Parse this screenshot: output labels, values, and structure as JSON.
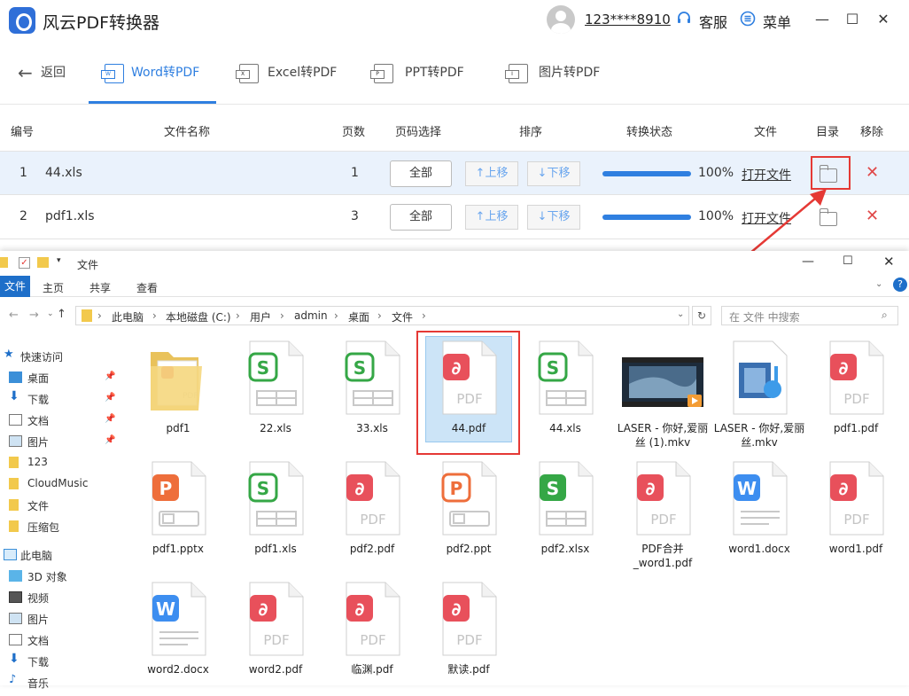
{
  "app": {
    "title": "风云PDF转换器",
    "username": "123****8910",
    "service": "客服",
    "menu": "菜单"
  },
  "nav": {
    "back": "返回",
    "tabs": [
      "Word转PDF",
      "Excel转PDF",
      "PPT转PDF",
      "图片转PDF"
    ]
  },
  "table": {
    "headers": [
      "编号",
      "文件名称",
      "页数",
      "页码选择",
      "排序",
      "转换状态",
      "文件",
      "目录",
      "移除"
    ],
    "rows": [
      {
        "num": "1",
        "name": "44.xls",
        "pages": "1",
        "range": "全部",
        "up": "↑上移",
        "down": "↓下移",
        "progress": 100,
        "status": "100%",
        "open": "打开文件"
      },
      {
        "num": "2",
        "name": "pdf1.xls",
        "pages": "3",
        "range": "全部",
        "up": "↑上移",
        "down": "↓下移",
        "progress": 100,
        "status": "100%",
        "open": "打开文件"
      }
    ]
  },
  "explorer": {
    "title": "文件",
    "ribbon": [
      "文件",
      "主页",
      "共享",
      "查看"
    ],
    "path": [
      "此电脑",
      "本地磁盘 (C:)",
      "用户",
      "admin",
      "桌面",
      "文件"
    ],
    "search_placeholder": "在 文件 中搜索",
    "sidebar": {
      "quick": "快速访问",
      "items": [
        "桌面",
        "下载",
        "文档",
        "图片",
        "123",
        "CloudMusic",
        "文件",
        "压缩包"
      ],
      "pc": "此电脑",
      "pc_items": [
        "3D 对象",
        "视频",
        "图片",
        "文档",
        "下载",
        "音乐"
      ]
    },
    "files": [
      {
        "name": "pdf1",
        "type": "folder"
      },
      {
        "name": "22.xls",
        "type": "xls"
      },
      {
        "name": "33.xls",
        "type": "xls"
      },
      {
        "name": "44.pdf",
        "type": "pdf"
      },
      {
        "name": "44.xls",
        "type": "xls"
      },
      {
        "name": "LASER - 你好,爱丽丝 (1).mkv",
        "type": "video"
      },
      {
        "name": "LASER - 你好,爱丽丝.mkv",
        "type": "audio"
      },
      {
        "name": "pdf1.pdf",
        "type": "pdf"
      },
      {
        "name": "pdf1.pptx",
        "type": "pptx"
      },
      {
        "name": "pdf1.xls",
        "type": "xls"
      },
      {
        "name": "pdf2.pdf",
        "type": "pdf"
      },
      {
        "name": "pdf2.ppt",
        "type": "ppt"
      },
      {
        "name": "pdf2.xlsx",
        "type": "xlsx"
      },
      {
        "name": "PDF合并_word1.pdf",
        "type": "pdf"
      },
      {
        "name": "word1.docx",
        "type": "docx"
      },
      {
        "name": "word1.pdf",
        "type": "pdf"
      },
      {
        "name": "word2.docx",
        "type": "docx"
      },
      {
        "name": "word2.pdf",
        "type": "pdf"
      },
      {
        "name": "临渊.pdf",
        "type": "pdf"
      },
      {
        "name": "默读.pdf",
        "type": "pdf"
      }
    ]
  },
  "colors": {
    "accent": "#2f7fe0",
    "pdf": "#e8505b",
    "xls": "#35a746",
    "ppt": "#ee6e3b",
    "doc": "#3d8ef0",
    "highlight": "#e53935"
  }
}
